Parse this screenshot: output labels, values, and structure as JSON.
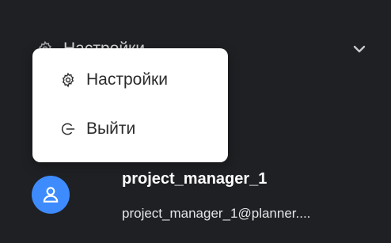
{
  "background_row": {
    "label": "Настройки",
    "icon": "gear-icon",
    "chevron": "chevron-down-icon"
  },
  "menu": {
    "items": [
      {
        "label": "Настройки",
        "icon": "gear-icon"
      },
      {
        "label": "Выйти",
        "icon": "logout-icon"
      }
    ]
  },
  "user": {
    "name": "project_manager_1",
    "email": "project_manager_1@planner....",
    "avatar_icon": "user-icon"
  },
  "colors": {
    "panel_bg": "#1f2023",
    "menu_bg": "#ffffff",
    "avatar_bg": "#3d8bfd",
    "text_light": "#ffffff",
    "text_dark": "#2b2b2e"
  }
}
